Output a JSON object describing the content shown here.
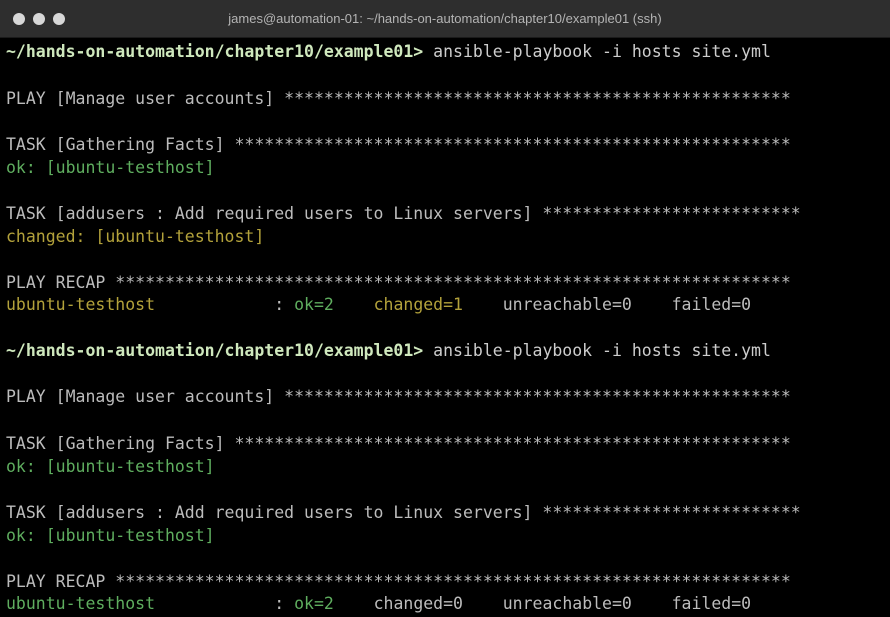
{
  "window": {
    "title": "james@automation-01: ~/hands-on-automation/chapter10/example01 (ssh)"
  },
  "colors": {
    "background": "#000000",
    "text": "#bcbcbc",
    "ok": "#5fae5f",
    "changed": "#b3a23b",
    "prompt": "#cfe8bd"
  },
  "terminal": {
    "runs": [
      {
        "prompt": "~/hands-on-automation/chapter10/example01>",
        "command": " ansible-playbook -i hosts site.yml",
        "play": "PLAY [Manage user accounts] ***************************************************",
        "task1": "TASK [Gathering Facts] ********************************************************",
        "task1_result": "ok: [ubuntu-testhost]",
        "task2": "TASK [addusers : Add required users to Linux servers] **************************",
        "task2_result": "changed: [ubuntu-testhost]",
        "recap": "PLAY RECAP ********************************************************************",
        "recap_host": "ubuntu-testhost",
        "recap_sep": "            : ",
        "recap_ok": "ok=2",
        "recap_changed": "    changed=1",
        "recap_rest": "    unreachable=0    failed=0"
      },
      {
        "prompt": "~/hands-on-automation/chapter10/example01>",
        "command": " ansible-playbook -i hosts site.yml",
        "play": "PLAY [Manage user accounts] ***************************************************",
        "task1": "TASK [Gathering Facts] ********************************************************",
        "task1_result": "ok: [ubuntu-testhost]",
        "task2": "TASK [addusers : Add required users to Linux servers] **************************",
        "task2_result": "ok: [ubuntu-testhost]",
        "recap": "PLAY RECAP ********************************************************************",
        "recap_host": "ubuntu-testhost",
        "recap_sep": "            : ",
        "recap_ok": "ok=2",
        "recap_changed": "    changed=0",
        "recap_rest": "    unreachable=0    failed=0"
      }
    ]
  }
}
